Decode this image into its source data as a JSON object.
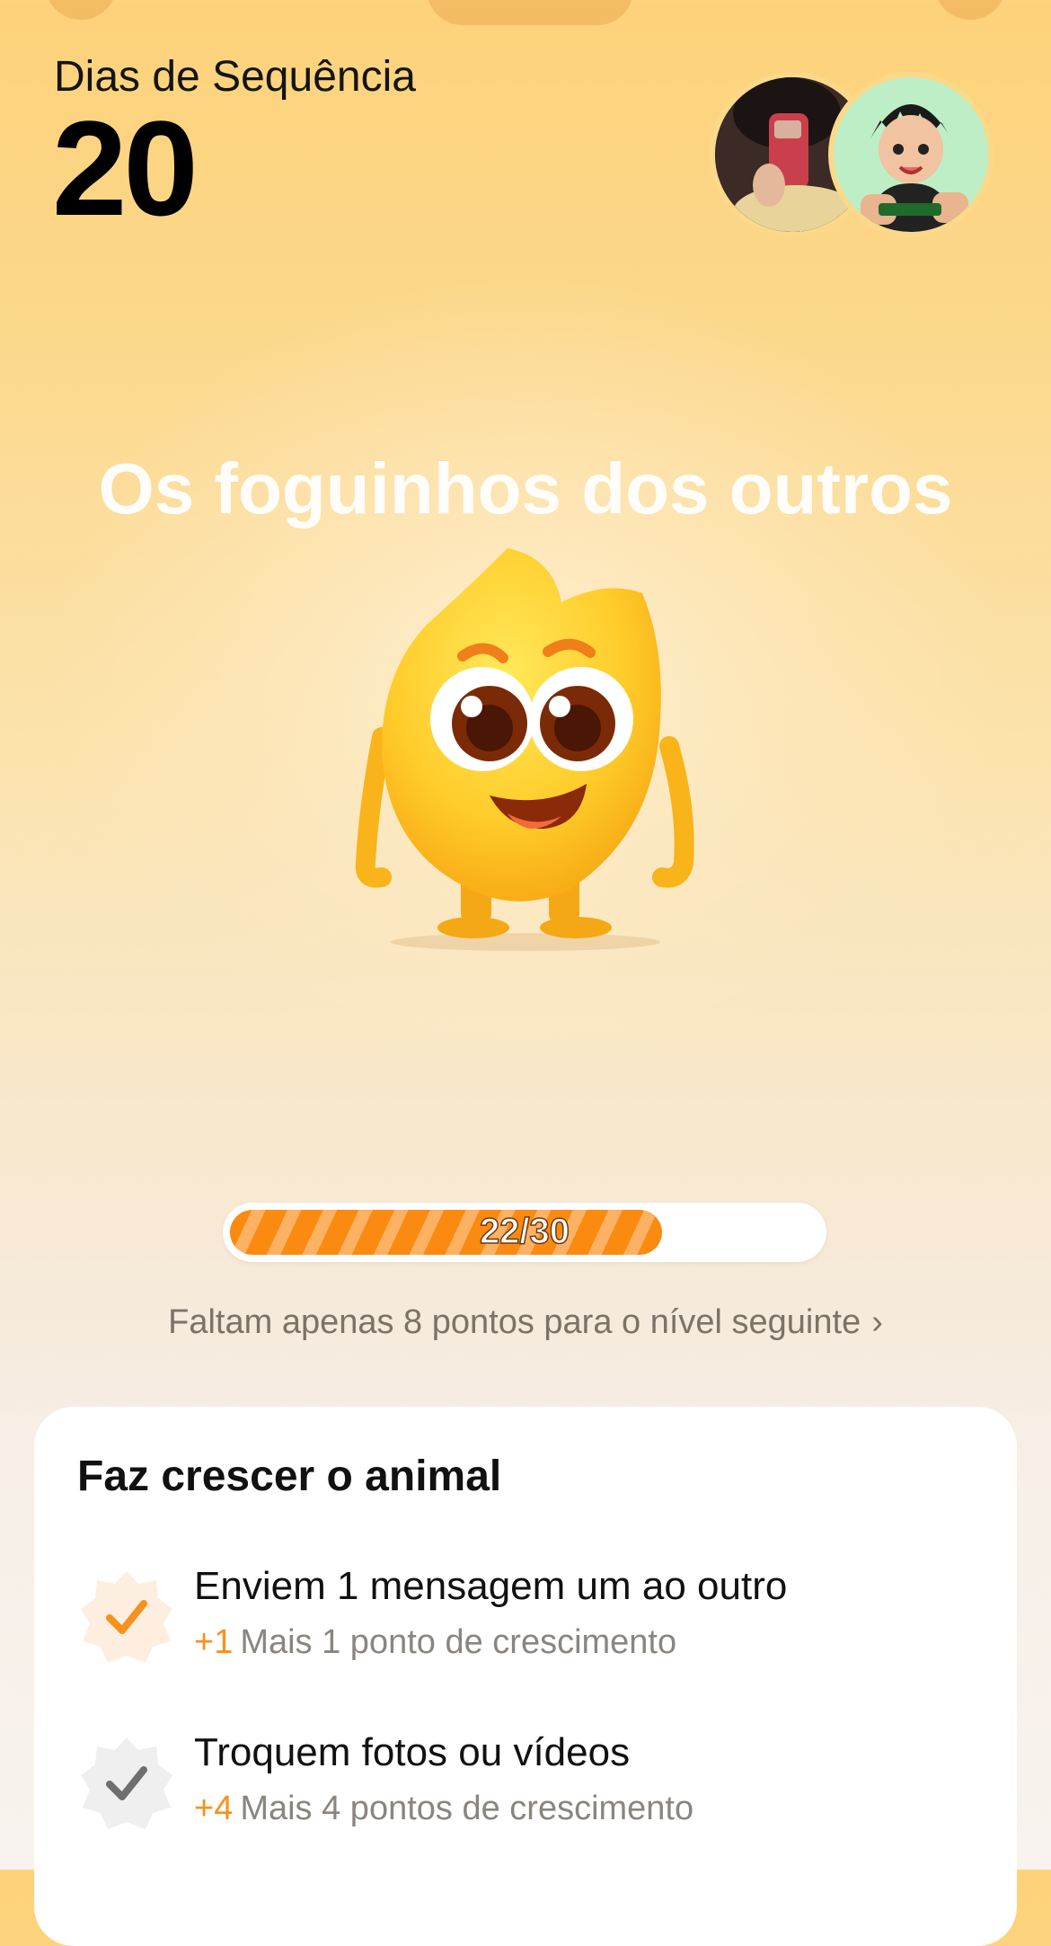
{
  "header": {
    "streak_label": "Dias de Sequência",
    "streak_count": "20"
  },
  "headline": "Os foguinhos dos outros",
  "progress": {
    "label": "22/30",
    "current": 22,
    "total": 30,
    "next_level_text": "Faltam apenas 8 pontos para o nível seguinte"
  },
  "card": {
    "title": "Faz crescer o animal",
    "tasks": [
      {
        "title": "Enviem 1 mensagem um ao outro",
        "points": "+1",
        "description": "Mais 1 ponto de crescimento",
        "status": "completed",
        "badge_color": "#fdeee0",
        "check_color": "#f6921e"
      },
      {
        "title": "Troquem fotos ou vídeos",
        "points": "+4",
        "description": "Mais 4 pontos de crescimento",
        "status": "pending",
        "badge_color": "#eeeeee",
        "check_color": "#6e6e6e"
      }
    ]
  },
  "colors": {
    "accent": "#f6921e",
    "progress_fill": "#fb8a10"
  }
}
